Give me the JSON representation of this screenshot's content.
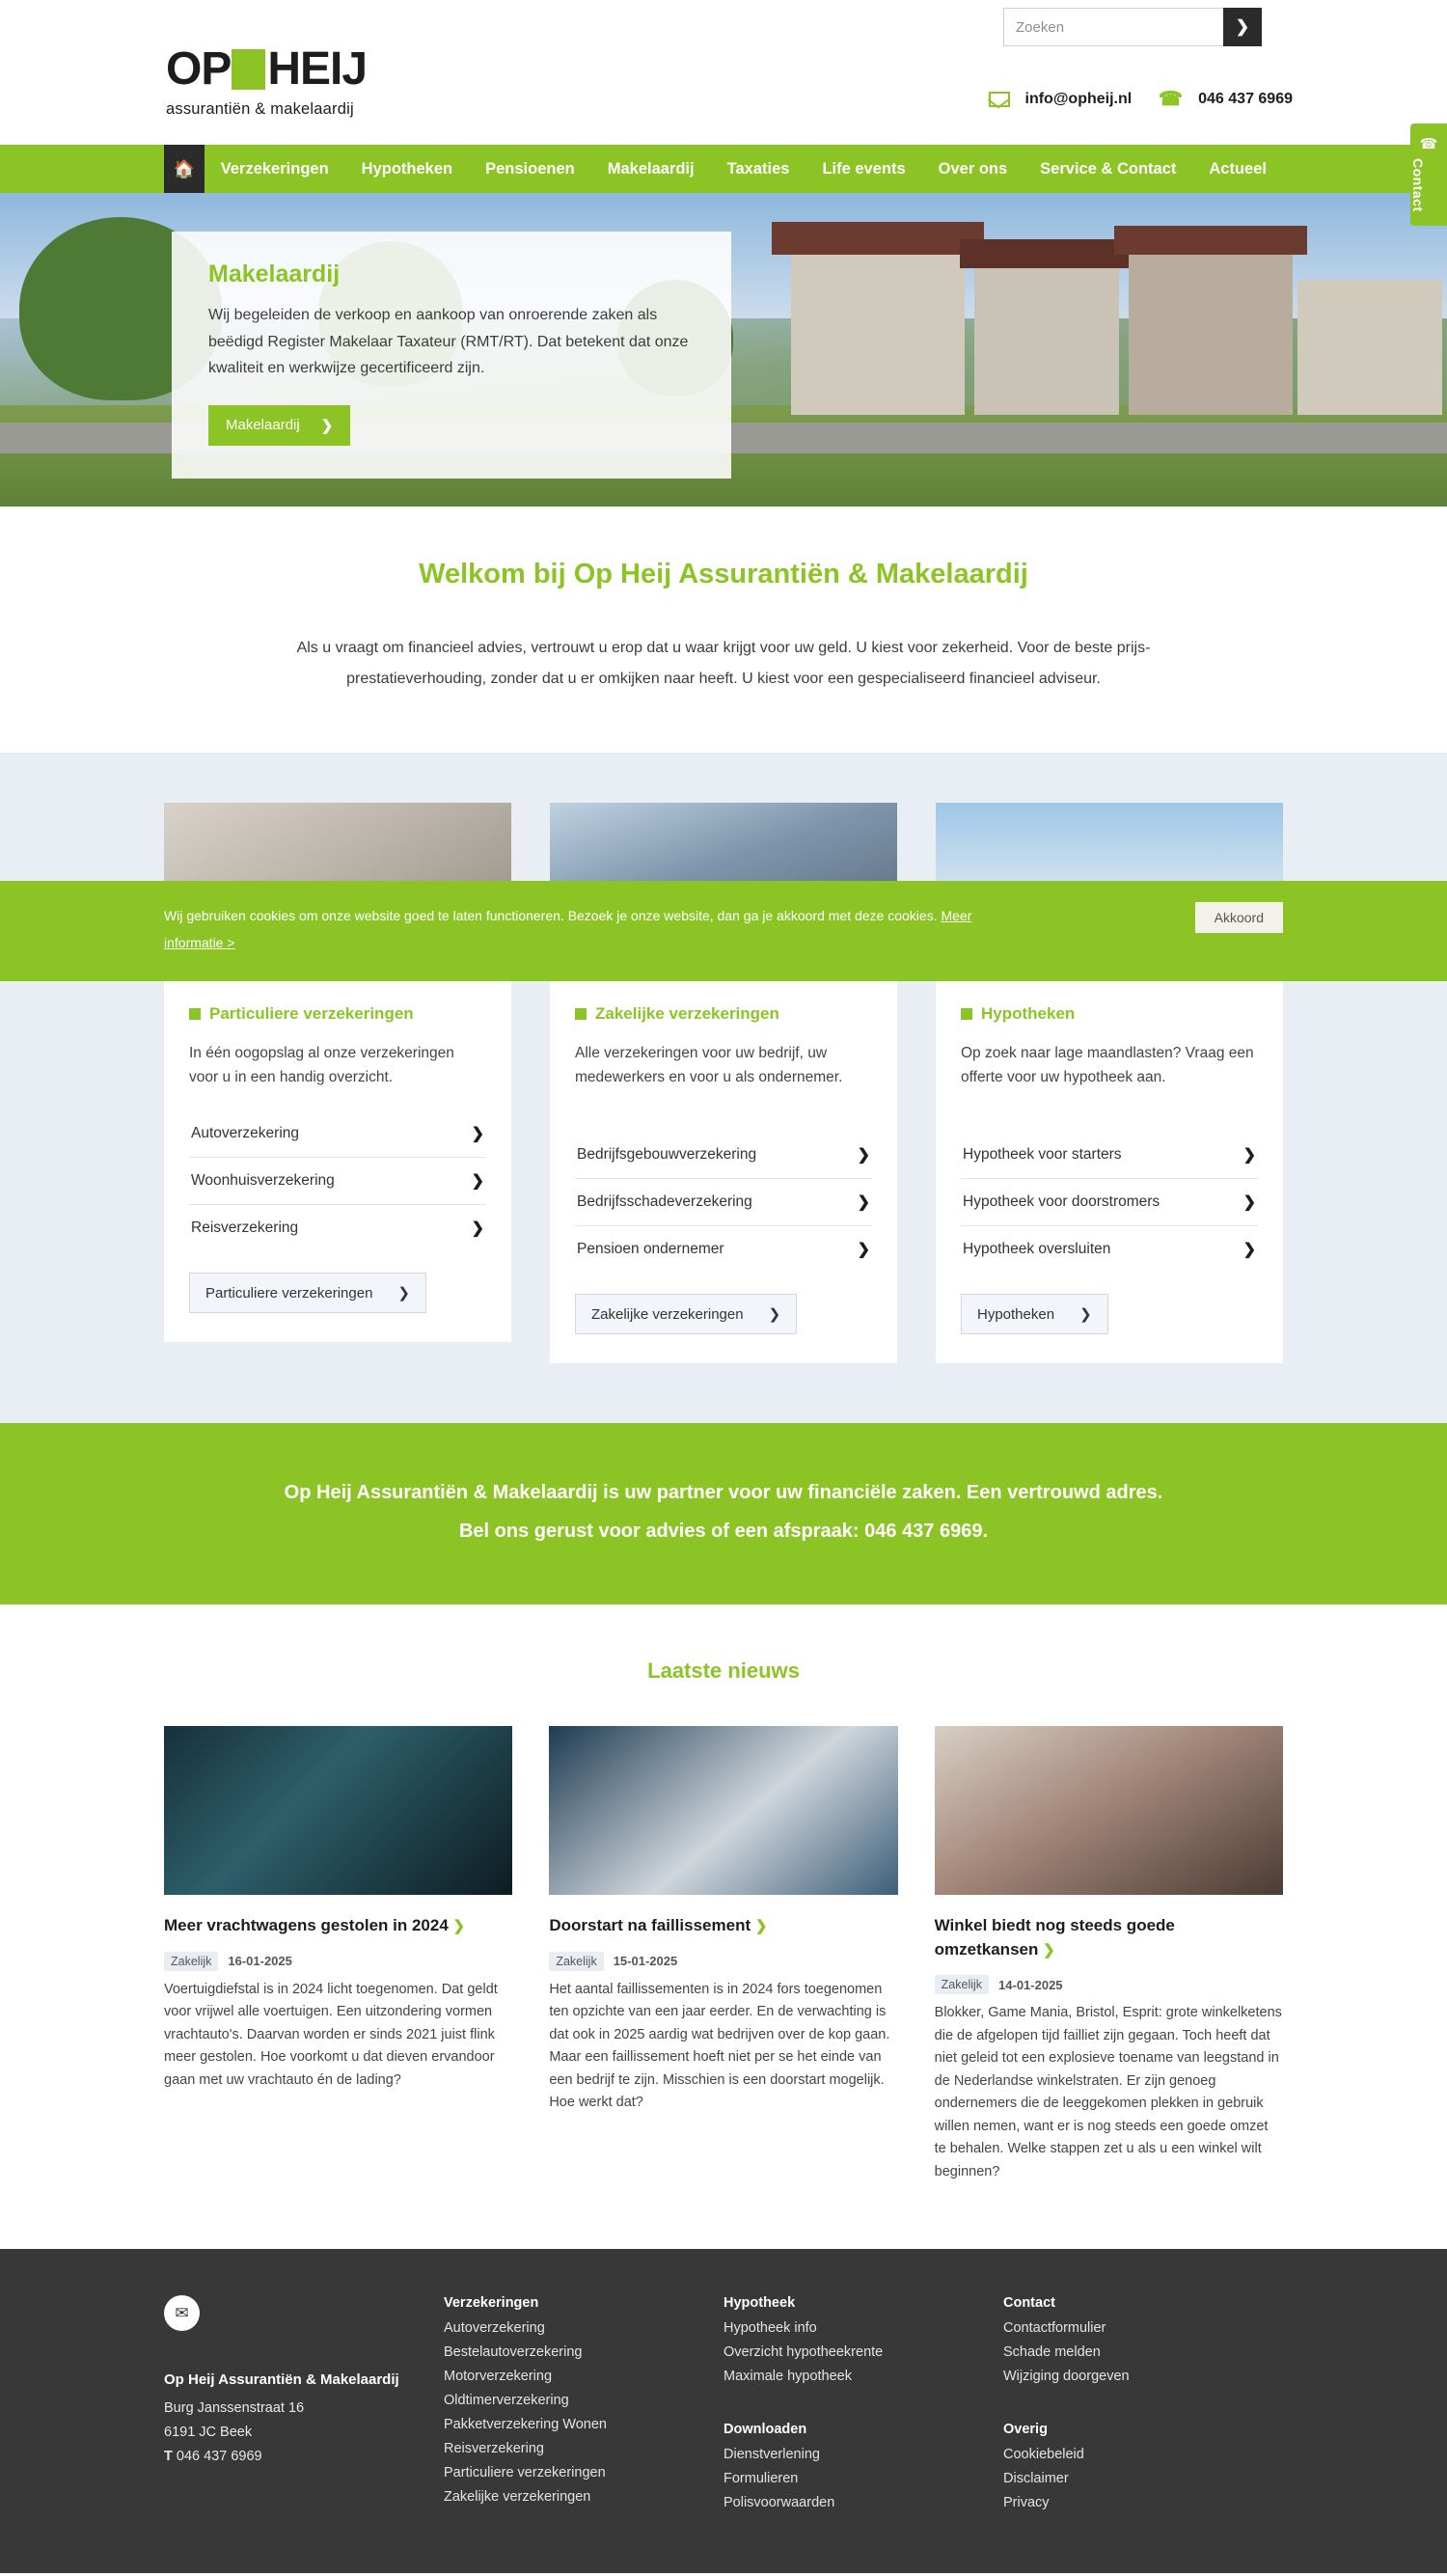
{
  "header": {
    "search": {
      "placeholder": "Zoeken",
      "value": "",
      "button_icon": "❯"
    },
    "logo": {
      "part1": "OP",
      "part2": "HEIJ",
      "subtitle": "assurantiën & makelaardij"
    },
    "contact": {
      "email": "info@opheij.nl",
      "phone": "046 437 6969"
    },
    "side_tab": {
      "label": "Contact",
      "icon": "phone-icon"
    }
  },
  "nav": {
    "home_icon": "home-icon",
    "items": [
      {
        "label": "Verzekeringen"
      },
      {
        "label": "Hypotheken"
      },
      {
        "label": "Pensioenen"
      },
      {
        "label": "Makelaardij"
      },
      {
        "label": "Taxaties"
      },
      {
        "label": "Life events"
      },
      {
        "label": "Over ons"
      },
      {
        "label": "Service & Contact"
      },
      {
        "label": "Actueel"
      }
    ]
  },
  "hero": {
    "title": "Makelaardij",
    "text": "Wij begeleiden de verkoop en aankoop van onroerende zaken als beëdigd Register Makelaar Taxateur (RMT/RT). Dat betekent dat onze kwaliteit en werkwijze gecertificeerd zijn.",
    "button": "Makelaardij",
    "chevron": "❯"
  },
  "welcome": {
    "title": "Welkom bij Op Heij Assurantiën & Makelaardij",
    "paragraph": "Als u vraagt om financieel advies, vertrouwt u erop dat u waar krijgt voor uw geld. U kiest voor zekerheid. Voor de beste prijs-prestatieverhouding, zonder dat u er omkijken naar heeft. U kiest voor een gespecialiseerd financieel adviseur."
  },
  "cards": [
    {
      "title": "Particuliere verzekeringen",
      "desc": "In één oogopslag al onze verzekeringen voor u in een handig overzicht.",
      "links": [
        "Autoverzekering",
        "Woonhuisverzekering",
        "Reisverzekering"
      ],
      "button": "Particuliere verzekeringen"
    },
    {
      "title": "Zakelijke verzekeringen",
      "desc": "Alle verzekeringen voor uw bedrijf, uw medewerkers en voor u als ondernemer.",
      "links": [
        "Bedrijfsgebouwverzekering",
        "Bedrijfsschadeverzekering",
        "Pensioen ondernemer"
      ],
      "button": "Zakelijke verzekeringen"
    },
    {
      "title": "Hypotheken",
      "desc": "Op zoek naar lage maandlasten? Vraag een offerte voor uw hypotheek aan.",
      "links": [
        "Hypotheek voor starters",
        "Hypotheek voor doorstromers",
        "Hypotheek oversluiten"
      ],
      "button": "Hypotheken"
    }
  ],
  "green_banner": {
    "line1": "Op Heij Assurantiën & Makelaardij is uw partner voor uw financiële zaken. Een vertrouwd adres.",
    "line2": "Bel ons gerust voor advies of een afspraak: 046 437 6969."
  },
  "news": {
    "title": "Laatste nieuws",
    "items": [
      {
        "title": "Meer vrachtwagens gestolen in 2024",
        "tag": "Zakelijk",
        "date": "16-01-2025",
        "body": "Voertuigdiefstal is in 2024 licht toegenomen. Dat geldt voor vrijwel alle voertuigen. Een uitzondering vormen vrachtauto's. Daarvan worden er sinds 2021 juist flink meer gestolen. Hoe voorkomt u dat dieven ervandoor gaan met uw vrachtauto én de lading?"
      },
      {
        "title": "Doorstart na faillissement",
        "tag": "Zakelijk",
        "date": "15-01-2025",
        "body": "Het aantal faillissementen is in 2024 fors toegenomen ten opzichte van een jaar eerder. En de verwachting is dat ook in 2025 aardig wat bedrijven over de kop gaan. Maar een faillissement hoeft niet per se het einde van een bedrijf te zijn. Misschien is een doorstart mogelijk. Hoe werkt dat?"
      },
      {
        "title": "Winkel biedt nog steeds goede omzetkansen",
        "tag": "Zakelijk",
        "date": "14-01-2025",
        "body": "Blokker, Game Mania, Bristol, Esprit: grote winkelketens die de afgelopen tijd failliet zijn gegaan. Toch heeft dat niet geleid tot een explosieve toename van leegstand in de Nederlandse winkelstraten. Er zijn genoeg ondernemers die de leeggekomen plekken in gebruik willen nemen, want er is nog steeds een goede omzet te behalen. Welke stappen zet u als u een winkel wilt beginnen?"
      }
    ]
  },
  "cookie": {
    "text_before": "Wij gebruiken cookies om onze website goed te laten functioneren. Bezoek je onze website, dan ga je akkoord met deze cookies.",
    "link": "Meer informatie >",
    "button": "Akkoord"
  },
  "footer": {
    "mail_icon": "envelope-icon",
    "company": "Op Heij Assurantiën & Makelaardij",
    "address_line1": "Burg Janssenstraat 16",
    "address_line2": "6191 JC Beek",
    "phone_prefix": "T",
    "phone": "046 437 6969",
    "columns": [
      {
        "groups": [
          {
            "head": "Verzekeringen",
            "links": [
              "Autoverzekering",
              "Bestelautoverzekering",
              "Motorverzekering",
              "Oldtimerverzekering",
              "Pakketverzekering Wonen",
              "Reisverzekering",
              "Particuliere verzekeringen",
              "Zakelijke verzekeringen"
            ]
          }
        ]
      },
      {
        "groups": [
          {
            "head": "Hypotheek",
            "links": [
              "Hypotheek info",
              "Overzicht hypotheekrente",
              "Maximale hypotheek"
            ]
          },
          {
            "head": "Downloaden",
            "links": [
              "Dienstverlening",
              "Formulieren",
              "Polisvoorwaarden"
            ]
          }
        ]
      },
      {
        "groups": [
          {
            "head": "Contact",
            "links": [
              "Contactformulier",
              "Schade melden",
              "Wijziging doorgeven"
            ]
          },
          {
            "head": "Overig",
            "links": [
              "Cookiebeleid",
              "Disclaimer",
              "Privacy"
            ]
          }
        ]
      }
    ]
  },
  "colors": {
    "brand_green": "#8cc425",
    "dark": "#383838",
    "card_bg": "#e9eef5"
  }
}
